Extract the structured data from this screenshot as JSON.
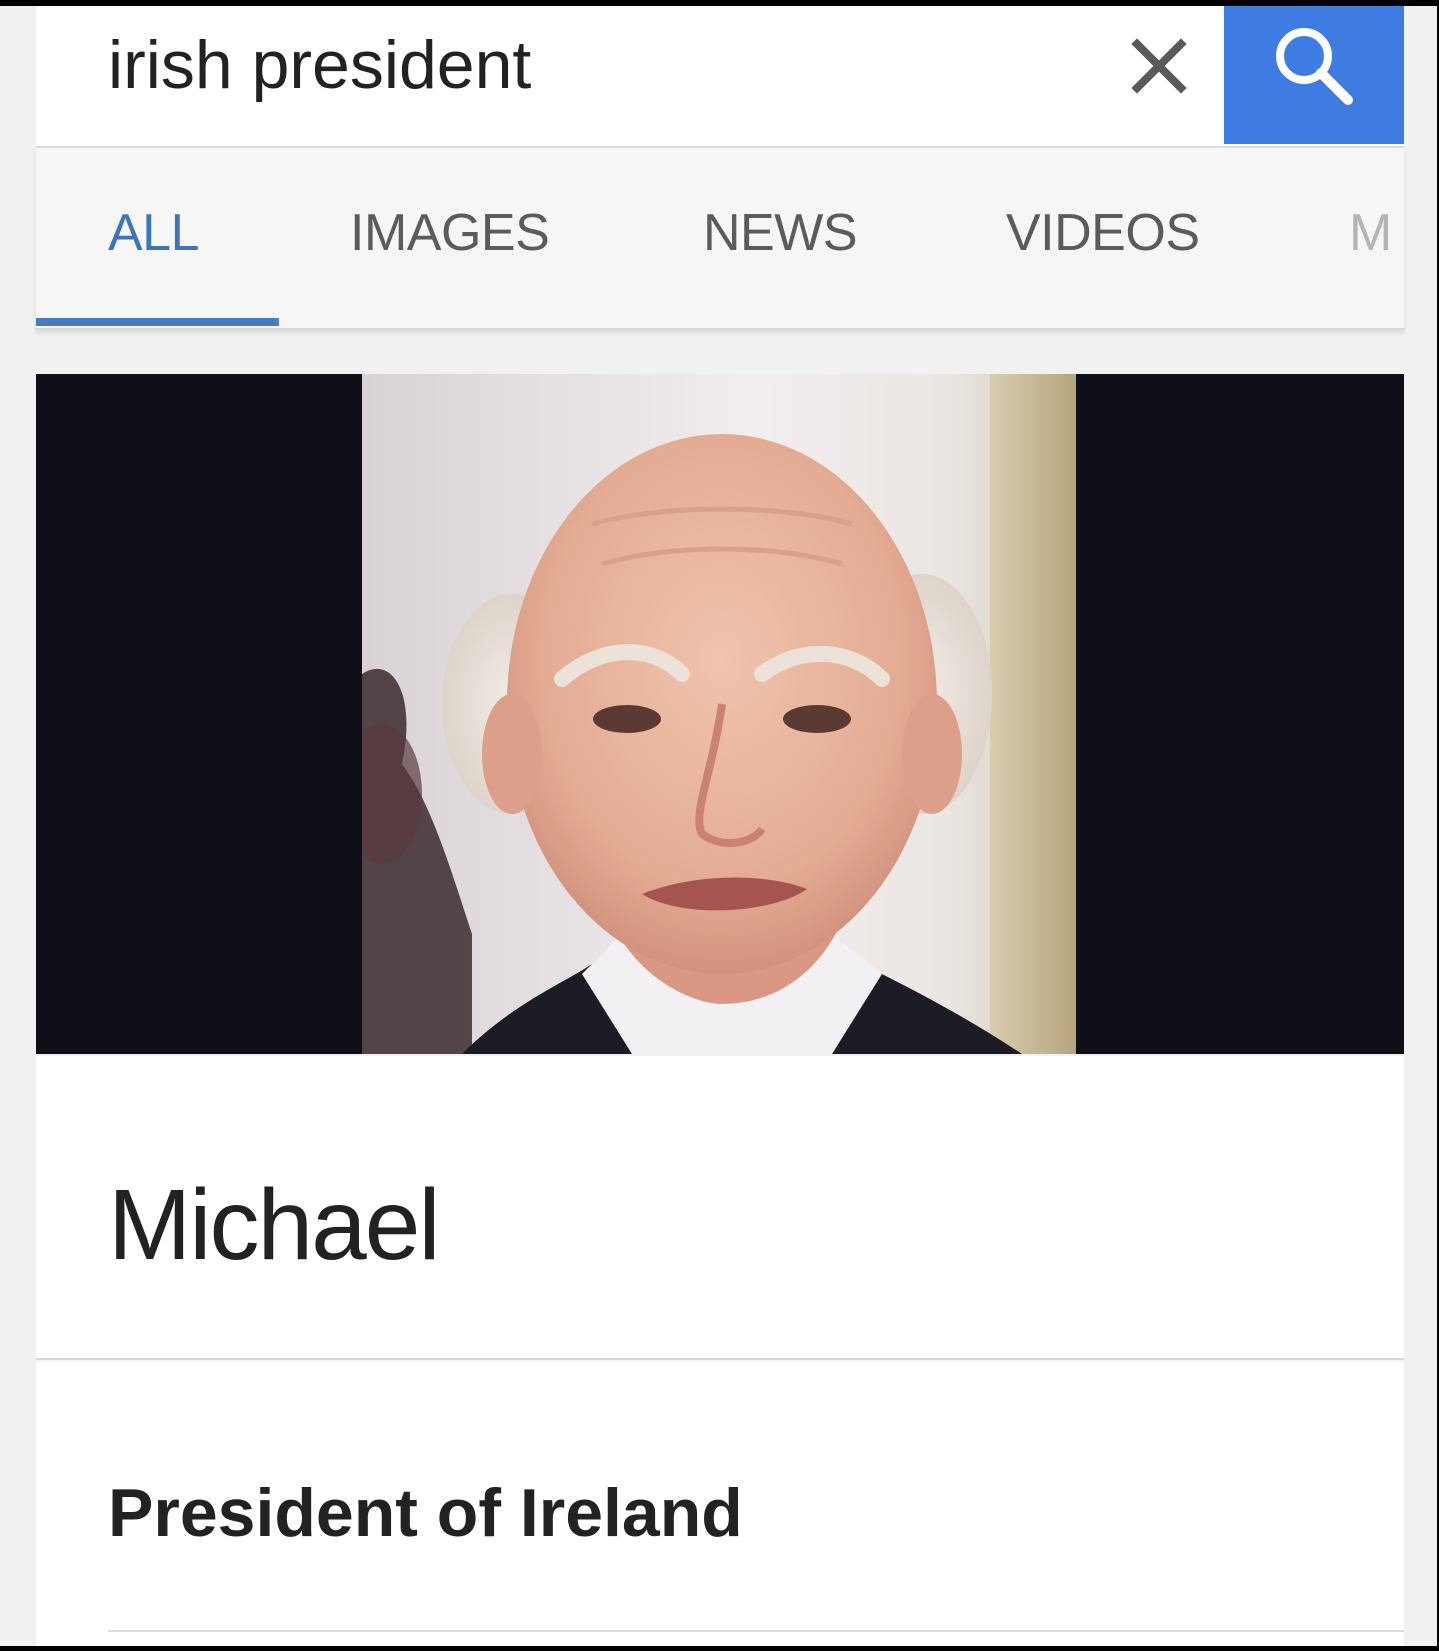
{
  "search": {
    "query": "irish president",
    "clear_icon": "close-icon",
    "search_icon": "search-icon"
  },
  "tabs": [
    {
      "label": "ALL",
      "active": true
    },
    {
      "label": "IMAGES",
      "active": false
    },
    {
      "label": "NEWS",
      "active": false
    },
    {
      "label": "VIDEOS",
      "active": false
    },
    {
      "label": "M",
      "active": false
    }
  ],
  "result": {
    "name": "Michael",
    "description": "President of Ireland"
  },
  "colors": {
    "accent": "#3f74b9",
    "search_button": "#3f7ce2",
    "tab_indicator": "#4a7cc0",
    "photo_background": "#0f0f19"
  }
}
